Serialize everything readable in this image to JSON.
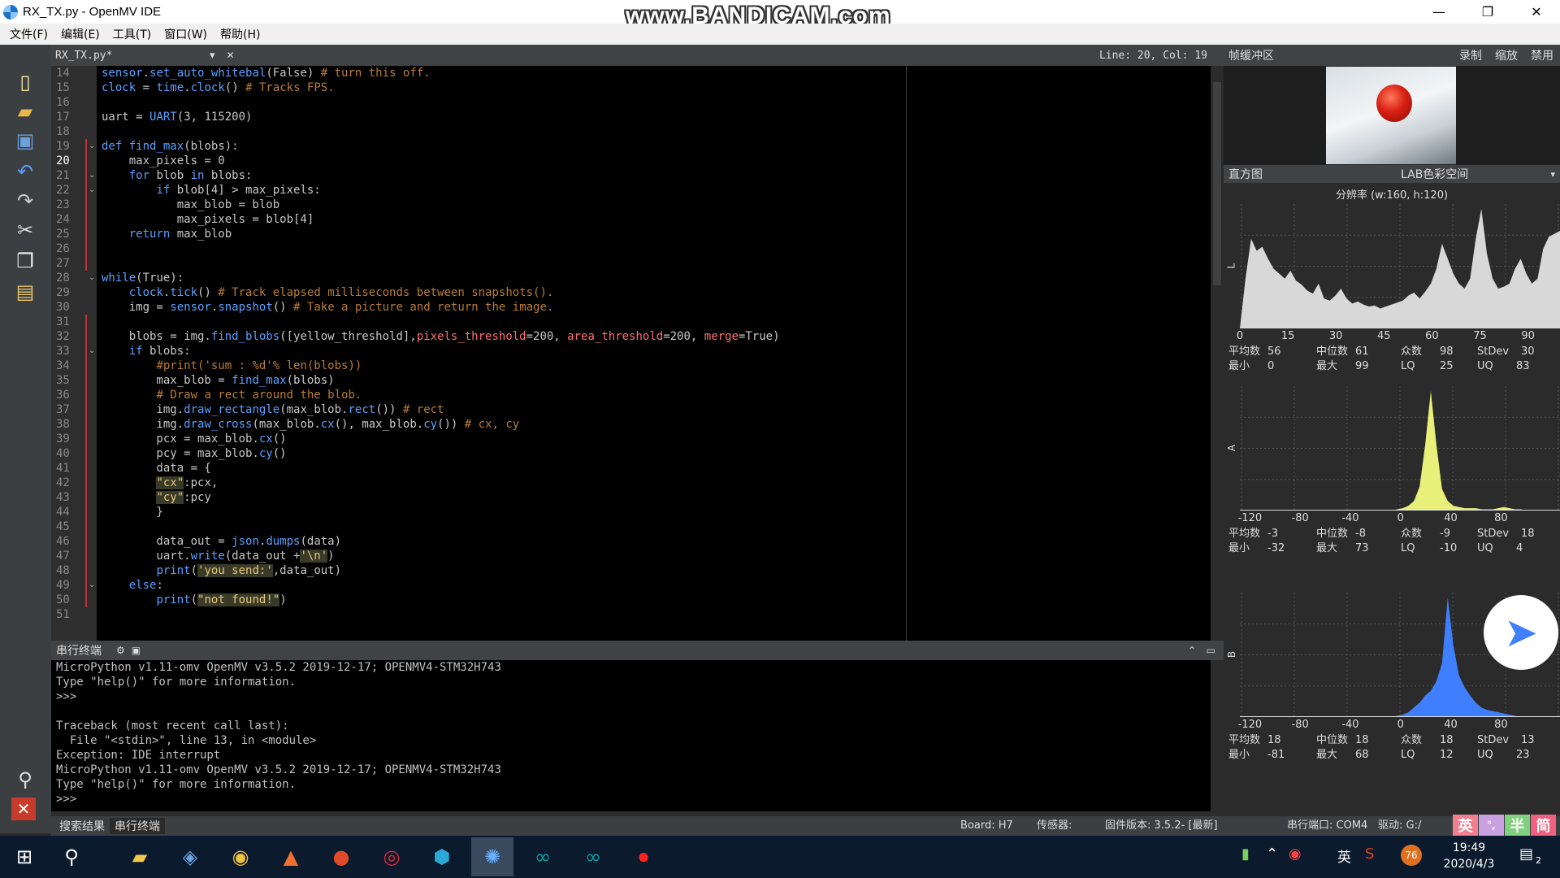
{
  "window": {
    "title": "RX_TX.py - OpenMV IDE",
    "watermark": "www.BANDICAM.com",
    "min": "—",
    "max": "❐",
    "close": "✕"
  },
  "menu": [
    "文件(F)",
    "编辑(E)",
    "工具(T)",
    "窗口(W)",
    "帮助(H)"
  ],
  "toolbar": {
    "icons": [
      "new-file-icon",
      "open-folder-icon",
      "save-icon",
      "undo-icon",
      "redo-icon",
      "cut-icon",
      "copy-icon",
      "paste-icon"
    ],
    "connect": "connect-icon",
    "stop": "stop-icon"
  },
  "editor": {
    "filename": "RX_TX.py*",
    "close": "✕",
    "dropdown": "▾",
    "cursor": "Line: 20, Col: 19",
    "current_line": 20,
    "lines": [
      {
        "n": "14",
        "t": "sensor.set_auto_whitebal(False) # turn this off."
      },
      {
        "n": "15",
        "t": "clock = time.clock() # Tracks FPS."
      },
      {
        "n": "16",
        "t": ""
      },
      {
        "n": "17",
        "t": "uart = UART(3, 115200)"
      },
      {
        "n": "18",
        "t": ""
      },
      {
        "n": "19",
        "t": "def find_max(blobs):"
      },
      {
        "n": "20",
        "t": "    max_pixels = 0"
      },
      {
        "n": "21",
        "t": "    for blob in blobs:"
      },
      {
        "n": "22",
        "t": "        if blob[4] > max_pixels:"
      },
      {
        "n": "23",
        "t": "           max_blob = blob"
      },
      {
        "n": "24",
        "t": "           max_pixels = blob[4]"
      },
      {
        "n": "25",
        "t": "    return max_blob"
      },
      {
        "n": "26",
        "t": ""
      },
      {
        "n": "27",
        "t": ""
      },
      {
        "n": "28",
        "t": "while(True):"
      },
      {
        "n": "29",
        "t": "    clock.tick() # Track elapsed milliseconds between snapshots()."
      },
      {
        "n": "30",
        "t": "    img = sensor.snapshot() # Take a picture and return the image."
      },
      {
        "n": "31",
        "t": ""
      },
      {
        "n": "32",
        "t": "    blobs = img.find_blobs([yellow_threshold],pixels_threshold=200, area_threshold=200, merge=True)"
      },
      {
        "n": "33",
        "t": "    if blobs:"
      },
      {
        "n": "34",
        "t": "        #print('sum : %d'% len(blobs))"
      },
      {
        "n": "35",
        "t": "        max_blob = find_max(blobs)"
      },
      {
        "n": "36",
        "t": "        # Draw a rect around the blob."
      },
      {
        "n": "37",
        "t": "        img.draw_rectangle(max_blob.rect()) # rect"
      },
      {
        "n": "38",
        "t": "        img.draw_cross(max_blob.cx(), max_blob.cy()) # cx, cy"
      },
      {
        "n": "39",
        "t": "        pcx = max_blob.cx()"
      },
      {
        "n": "40",
        "t": "        pcy = max_blob.cy()"
      },
      {
        "n": "41",
        "t": "        data = {"
      },
      {
        "n": "42",
        "t": "        \"cx\":pcx,"
      },
      {
        "n": "43",
        "t": "        \"cy\":pcy"
      },
      {
        "n": "44",
        "t": "        }"
      },
      {
        "n": "45",
        "t": ""
      },
      {
        "n": "46",
        "t": "        data_out = json.dumps(data)"
      },
      {
        "n": "47",
        "t": "        uart.write(data_out +'\\n')"
      },
      {
        "n": "48",
        "t": "        print('you send:',data_out)"
      },
      {
        "n": "49",
        "t": "    else:"
      },
      {
        "n": "50",
        "t": "        print(\"not found!\")"
      },
      {
        "n": "51",
        "t": ""
      }
    ]
  },
  "terminal": {
    "title": "串行终端",
    "lines": [
      "MicroPython v1.11-omv OpenMV v3.5.2 2019-12-17; OPENMV4-STM32H743",
      "Type \"help()\" for more information.",
      ">>>",
      "",
      "Traceback (most recent call last):",
      "  File \"<stdin>\", line 13, in <module>",
      "Exception: IDE interrupt",
      "MicroPython v1.11-omv OpenMV v3.5.2 2019-12-17; OPENMV4-STM32H743",
      "Type \"help()\" for more information.",
      ">>>"
    ]
  },
  "bottom_tabs": [
    "搜索结果",
    "串行终端"
  ],
  "status": {
    "board": "Board: H7",
    "sensor": "传感器:",
    "firmware": "固件版本: 3.5.2- [最新]",
    "port": "串行端口: COM4",
    "drive": "驱动: G:/"
  },
  "ime": [
    "英",
    "°,",
    "半",
    "简"
  ],
  "framebuffer": {
    "title": "帧缓冲区",
    "record": "录制",
    "zoom": "缩放",
    "disable": "禁用"
  },
  "histogram": {
    "title": "直方图",
    "colorspace": "LAB色彩空间",
    "resolution": "分辨率 (w:160, h:120)",
    "channels": [
      {
        "axis": "L",
        "ticks": [
          "0",
          "15",
          "30",
          "45",
          "60",
          "75",
          "90"
        ],
        "tick_range": [
          0,
          100
        ],
        "color": "#d8d8d8",
        "stats": {
          "mean": "56",
          "median": "61",
          "mode": "98",
          "stdev": "30",
          "min": "0",
          "max": "99",
          "lq": "25",
          "uq": "83"
        },
        "bins": [
          0,
          50,
          90,
          78,
          82,
          70,
          60,
          55,
          50,
          58,
          48,
          44,
          38,
          35,
          45,
          30,
          28,
          33,
          40,
          30,
          25,
          27,
          24,
          22,
          23,
          20,
          22,
          24,
          26,
          28,
          33,
          36,
          30,
          37,
          45,
          60,
          85,
          70,
          55,
          45,
          40,
          50,
          90,
          120,
          75,
          50,
          40,
          42,
          45,
          60,
          70,
          55,
          45,
          50,
          80,
          92,
          95,
          98
        ]
      },
      {
        "axis": "A",
        "ticks": [
          "-120",
          "-80",
          "-40",
          "0",
          "40",
          "80"
        ],
        "tick_range": [
          -128,
          127
        ],
        "color": "#e8f07a",
        "stats": {
          "mean": "-3",
          "median": "-8",
          "mode": "-9",
          "stdev": "18",
          "min": "-32",
          "max": "73",
          "lq": "-10",
          "uq": "4"
        },
        "bins": [
          0,
          0,
          0,
          0,
          0,
          0,
          0,
          0,
          0,
          0,
          0,
          0,
          0,
          0,
          0,
          0,
          0,
          0,
          0,
          0,
          0,
          0,
          0,
          0,
          0,
          0,
          0,
          0,
          1,
          2,
          4,
          8,
          20,
          55,
          100,
          55,
          18,
          8,
          4,
          3,
          2,
          2,
          2,
          1,
          1,
          1,
          2,
          3,
          2,
          1,
          1,
          0,
          0,
          0,
          0,
          0,
          0,
          0
        ]
      },
      {
        "axis": "B",
        "ticks": [
          "-120",
          "-80",
          "-40",
          "0",
          "40",
          "80"
        ],
        "tick_range": [
          -128,
          127
        ],
        "color": "#3f7fff",
        "stats": {
          "mean": "18",
          "median": "18",
          "mode": "18",
          "stdev": "13",
          "min": "-81",
          "max": "68",
          "lq": "12",
          "uq": "23"
        },
        "bins": [
          0,
          0,
          0,
          0,
          0,
          0,
          0,
          0,
          0,
          0,
          0,
          0,
          0,
          0,
          0,
          0,
          0,
          0,
          0,
          0,
          0,
          0,
          0,
          0,
          0,
          0,
          0,
          0,
          1,
          2,
          4,
          8,
          12,
          18,
          22,
          30,
          45,
          100,
          60,
          35,
          25,
          18,
          12,
          8,
          6,
          5,
          4,
          3,
          2,
          1,
          0,
          0,
          0,
          0,
          0,
          0,
          0,
          0
        ]
      }
    ],
    "labels": {
      "mean": "平均数",
      "median": "中位数",
      "mode": "众数",
      "stdev": "StDev",
      "min": "最小",
      "max": "最大",
      "lq": "LQ",
      "uq": "UQ"
    }
  },
  "taskbar": {
    "apps": [
      "windows-icon",
      "search-icon",
      "file-explorer-icon",
      "python-icon",
      "chrome-icon",
      "matlab-icon",
      "powerpoint-icon",
      "netease-music-icon",
      "app-icon",
      "openmv-icon",
      "arduino-icon",
      "arduino-icon-2",
      "record-icon"
    ],
    "tray_lang": "英",
    "tray_badge": "76",
    "time": "19:49",
    "date": "2020/4/3",
    "notifications": "2"
  }
}
